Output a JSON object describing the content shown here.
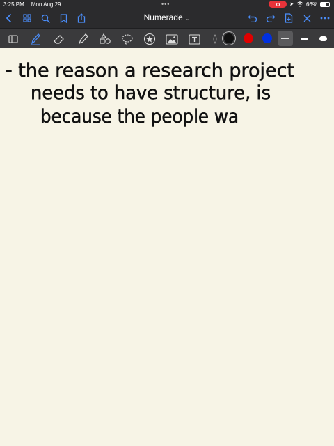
{
  "status": {
    "time": "3:25 PM",
    "date": "Mon Aug 29",
    "battery_text": "66%",
    "battery_level": 0.66
  },
  "nav": {
    "title": "Numerade",
    "icons": [
      "back-chevron-icon",
      "grid-icon",
      "search-icon",
      "bookmark-icon",
      "share-icon",
      "undo-icon",
      "redo-icon",
      "add-page-icon",
      "close-icon",
      "more-icon"
    ]
  },
  "toolbar": {
    "tools": [
      "sidebar-toggle-icon",
      "pen-icon",
      "eraser-icon",
      "highlighter-icon",
      "shapes-icon",
      "lasso-icon",
      "sticker-icon",
      "image-icon",
      "text-icon",
      "laser-icon"
    ],
    "colors": [
      "#111111",
      "#e00000",
      "#0030e0"
    ],
    "selected_color": "#111111",
    "widths": [
      "thin",
      "medium",
      "thick"
    ],
    "selected_width": "thin"
  },
  "note": {
    "lines": [
      "- the reason a research project",
      "needs to have structure, is",
      "because the people wa"
    ]
  }
}
